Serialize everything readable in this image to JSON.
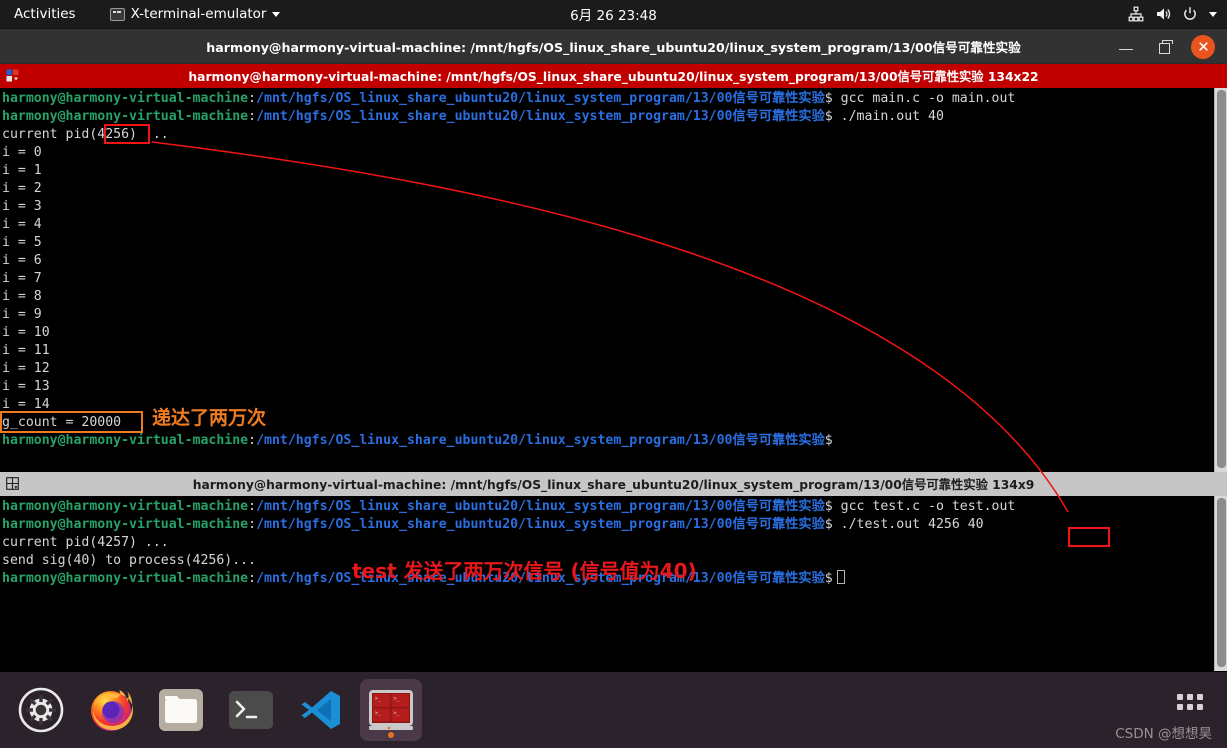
{
  "topbar": {
    "activities": "Activities",
    "app_name": "X-terminal-emulator",
    "clock": "6月 26 23:48"
  },
  "window": {
    "title": "harmony@harmony-virtual-machine: /mnt/hgfs/OS_linux_share_ubuntu20/linux_system_program/13/00信号可靠性实验",
    "minimize_label": "minimize",
    "maximize_label": "restore",
    "close_label": "close"
  },
  "panes": [
    {
      "title": "harmony@harmony-virtual-machine: /mnt/hgfs/OS_linux_share_ubuntu20/linux_system_program/13/00信号可靠性实验 134x22",
      "state": "active",
      "prompt_user": "harmony@harmony-virtual-machine",
      "prompt_path": "/mnt/hgfs/OS_linux_share_ubuntu20/linux_system_program/13/00信号可靠性实验",
      "lines": [
        {
          "type": "prompt",
          "command": " gcc main.c -o main.out"
        },
        {
          "type": "prompt",
          "command": " ./main.out 40"
        },
        {
          "type": "out",
          "text": "current pid(4256) ..."
        },
        {
          "type": "out",
          "text": "i = 0"
        },
        {
          "type": "out",
          "text": "i = 1"
        },
        {
          "type": "out",
          "text": "i = 2"
        },
        {
          "type": "out",
          "text": "i = 3"
        },
        {
          "type": "out",
          "text": "i = 4"
        },
        {
          "type": "out",
          "text": "i = 5"
        },
        {
          "type": "out",
          "text": "i = 6"
        },
        {
          "type": "out",
          "text": "i = 7"
        },
        {
          "type": "out",
          "text": "i = 8"
        },
        {
          "type": "out",
          "text": "i = 9"
        },
        {
          "type": "out",
          "text": "i = 10"
        },
        {
          "type": "out",
          "text": "i = 11"
        },
        {
          "type": "out",
          "text": "i = 12"
        },
        {
          "type": "out",
          "text": "i = 13"
        },
        {
          "type": "out",
          "text": "i = 14"
        },
        {
          "type": "out",
          "text": "g_count = 20000"
        },
        {
          "type": "prompt",
          "command": ""
        }
      ]
    },
    {
      "title": "harmony@harmony-virtual-machine: /mnt/hgfs/OS_linux_share_ubuntu20/linux_system_program/13/00信号可靠性实验 134x9",
      "state": "inactive",
      "prompt_user": "harmony@harmony-virtual-machine",
      "prompt_path": "/mnt/hgfs/OS_linux_share_ubuntu20/linux_system_program/13/00信号可靠性实验",
      "lines": [
        {
          "type": "prompt",
          "command": " gcc test.c -o test.out"
        },
        {
          "type": "prompt",
          "command": " ./test.out 4256 40"
        },
        {
          "type": "out",
          "text": "current pid(4257) ..."
        },
        {
          "type": "out",
          "text": "send sig(40) to process(4256)..."
        },
        {
          "type": "prompt",
          "command": ""
        }
      ]
    }
  ],
  "annotations": {
    "pid_box_top_value": "4256",
    "pid_box_bottom_value": "4256",
    "gcount_box_value": "g_count = 20000",
    "note_orange": "递达了两万次",
    "note_red": "test 发送了两万次信号 (信号值为40)",
    "colors": {
      "red": "#f21515",
      "orange": "#f07c21",
      "note_red": "#e8171b"
    }
  },
  "dock": {
    "items": [
      {
        "name": "settings",
        "label": "Settings"
      },
      {
        "name": "firefox",
        "label": "Firefox"
      },
      {
        "name": "files",
        "label": "Files"
      },
      {
        "name": "terminal",
        "label": "Terminal"
      },
      {
        "name": "vscode",
        "label": "Visual Studio Code"
      },
      {
        "name": "terminator",
        "label": "Terminator",
        "active": true
      }
    ],
    "show_apps_label": "Show Applications"
  },
  "watermark": "CSDN @想想昊"
}
